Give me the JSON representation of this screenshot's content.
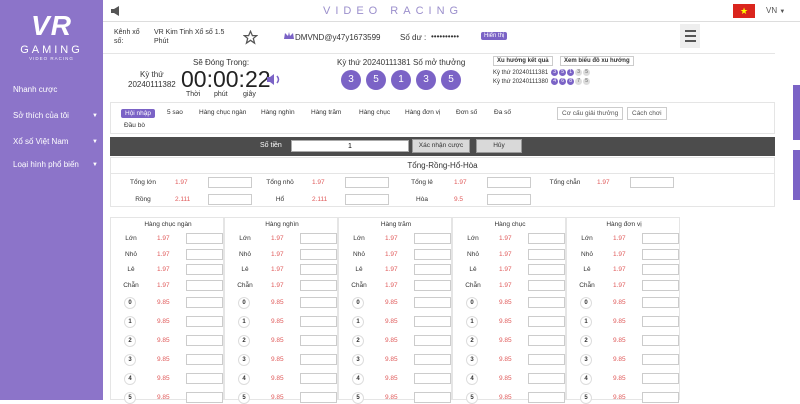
{
  "brand": {
    "logo": "VR",
    "name": "GAMING",
    "tagline": "VIDEO RACING"
  },
  "sidebar": {
    "items": [
      {
        "label": "Nhanh cược",
        "caret": false
      },
      {
        "label": "Sở thích của tôi",
        "caret": true
      },
      {
        "label": "Xổ số Việt Nam",
        "caret": true
      },
      {
        "label": "Loại hình phổ biến",
        "caret": true
      }
    ]
  },
  "topbar": {
    "title": "VIDEO RACING",
    "lang": "VN"
  },
  "info": {
    "lottery_label": "Kênh xổ số:",
    "lottery_name": "VR Kim Tinh Xổ số 1.5 Phút",
    "user": "DMVND@y47y1673599",
    "balance_label": "Số dư :",
    "balance_value": "••••••••••",
    "show_btn": "Hiển thị"
  },
  "draw": {
    "period_label": "Kỳ thứ",
    "period": "20240111382",
    "countdown_label": "Sẽ Đóng Trong:",
    "countdown": "00:00:22",
    "units": [
      "Thời",
      "phút",
      "giây"
    ],
    "last_label": "Kỳ thứ 20240111381",
    "result_label": "Số mở thưởng",
    "balls": [
      "3",
      "5",
      "1",
      "3",
      "5"
    ]
  },
  "trend": {
    "btn1": "Xu hướng kết quả",
    "btn2": "Xem biểu đồ xu hướng",
    "rows": [
      {
        "label": "Kỳ thứ 20240111381",
        "balls": [
          "3",
          "5",
          "1",
          "3",
          "5"
        ]
      },
      {
        "label": "Kỳ thứ 20240111380",
        "balls": [
          "4",
          "6",
          "8",
          "7",
          "5"
        ]
      }
    ]
  },
  "tabs": {
    "items": [
      "Hội nhập",
      "5 sao",
      "Hàng chục ngàn",
      "Hàng nghìn",
      "Hàng trăm",
      "Hàng chục",
      "Hàng đơn vị",
      "Đơn số",
      "Đa số",
      "Đầu bò"
    ],
    "active": "Hội nhập",
    "btn_rules": "Cơ cấu giải thưởng",
    "btn_howto": "Cách chơi"
  },
  "amount": {
    "label": "Số tiền",
    "value": "1",
    "confirm": "Xác nhận cược",
    "cancel": "Hủy"
  },
  "dragon": {
    "title": "Tổng-Rồng-Hổ-Hòa",
    "rows": [
      [
        {
          "label": "Tổng lớn",
          "odd": "1.97"
        },
        {
          "label": "Tổng nhỏ",
          "odd": "1.97"
        },
        {
          "label": "Tổng lẻ",
          "odd": "1.97"
        },
        {
          "label": "Tổng chẵn",
          "odd": "1.97"
        }
      ],
      [
        {
          "label": "Rồng",
          "odd": "2.111"
        },
        {
          "label": "Hổ",
          "odd": "2.111"
        },
        {
          "label": "Hòa",
          "odd": "9.5"
        }
      ]
    ]
  },
  "positions": {
    "columns": [
      "Hàng chục ngàn",
      "Hàng nghìn",
      "Hàng trăm",
      "Hàng chục",
      "Hàng đơn vị"
    ],
    "attr_rows": [
      {
        "label": "Lớn",
        "odd": "1.97"
      },
      {
        "label": "Nhỏ",
        "odd": "1.97"
      },
      {
        "label": "Lẻ",
        "odd": "1.97"
      },
      {
        "label": "Chẵn",
        "odd": "1.97"
      }
    ],
    "num_rows": [
      {
        "label": "0",
        "odd": "9.85"
      },
      {
        "label": "1",
        "odd": "9.85"
      },
      {
        "label": "2",
        "odd": "9.85"
      },
      {
        "label": "3",
        "odd": "9.85"
      },
      {
        "label": "4",
        "odd": "9.85"
      },
      {
        "label": "5",
        "odd": "9.85"
      }
    ]
  }
}
